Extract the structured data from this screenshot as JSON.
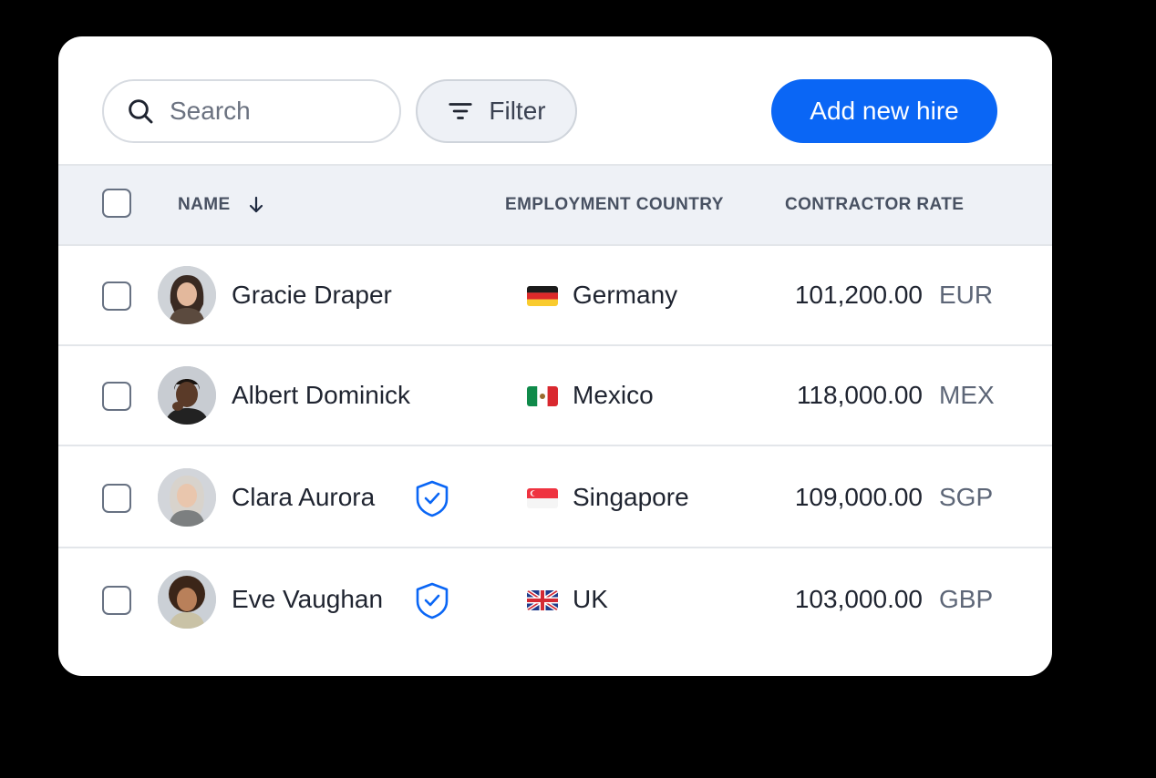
{
  "toolbar": {
    "search_placeholder": "Search",
    "filter_label": "Filter",
    "add_label": "Add new hire"
  },
  "table": {
    "columns": {
      "name": "NAME",
      "country": "EMPLOYMENT COUNTRY",
      "rate": "CONTRACTOR RATE"
    },
    "sort": {
      "column": "name",
      "direction": "descending-arrow"
    },
    "rows": [
      {
        "name": "Gracie Draper",
        "verified": false,
        "flag": "germany-flag",
        "country": "Germany",
        "amount": "101,200.00",
        "currency": "EUR"
      },
      {
        "name": "Albert Dominick",
        "verified": false,
        "flag": "mexico-flag",
        "country": "Mexico",
        "amount": "118,000.00",
        "currency": "MEX"
      },
      {
        "name": "Clara Aurora",
        "verified": true,
        "flag": "singapore-flag",
        "country": "Singapore",
        "amount": "109,000.00",
        "currency": "SGP"
      },
      {
        "name": "Eve Vaughan",
        "verified": true,
        "flag": "uk-flag",
        "country": "UK",
        "amount": "103,000.00",
        "currency": "GBP"
      }
    ]
  },
  "colors": {
    "primary": "#0a66f5",
    "header_bg": "#eef1f6",
    "verified_icon": "#0a66f5",
    "text": "#1f2430"
  }
}
